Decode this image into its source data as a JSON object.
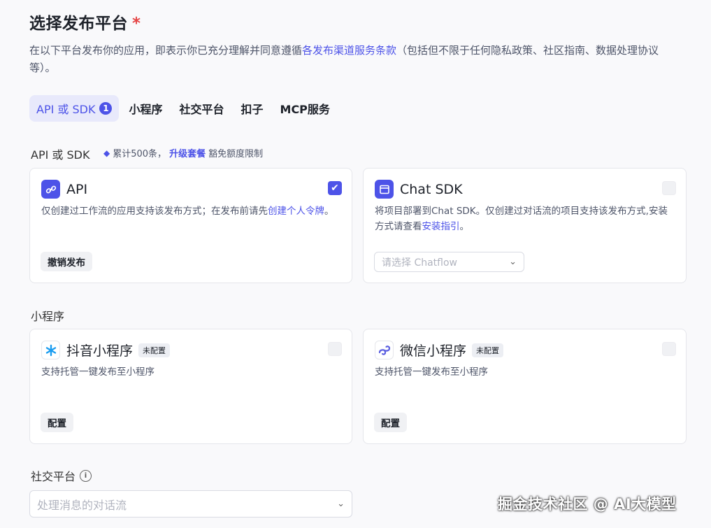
{
  "header": {
    "title": "选择发布平台",
    "required_mark": "*",
    "desc_before": "在以下平台发布你的应用，即表示你已充分理解并同意遵循",
    "desc_link": "各发布渠道服务条款",
    "desc_after": "（包括但不限于任何隐私政策、社区指南、数据处理协议等）。"
  },
  "tabs": [
    {
      "label": "API 或 SDK",
      "badge": "1"
    },
    {
      "label": "小程序"
    },
    {
      "label": "社交平台"
    },
    {
      "label": "扣子"
    },
    {
      "label": "MCP服务"
    }
  ],
  "api_section": {
    "label": "API 或 SDK",
    "quota_text": "累计500条，",
    "upgrade_link": "升级套餐",
    "quota_after": "豁免额度限制"
  },
  "api_card": {
    "title": "API",
    "desc_before": "仅创建过工作流的应用支持该发布方式；在发布前请先",
    "desc_link": "创建个人令牌",
    "desc_after": "。",
    "button": "撤销发布",
    "checked": true
  },
  "chatsdk_card": {
    "title": "Chat SDK",
    "desc_before": "将项目部署到Chat SDK。仅创建过对话流的项目支持该发布方式,安装方式请查看",
    "desc_link": "安装指引",
    "desc_after": "。",
    "select_placeholder": "请选择 Chatflow"
  },
  "mini_section": {
    "label": "小程序"
  },
  "douyin_card": {
    "title": "抖音小程序",
    "status": "未配置",
    "desc": "支持托管一键发布至小程序",
    "button": "配置"
  },
  "wechat_card": {
    "title": "微信小程序",
    "status": "未配置",
    "desc": "支持托管一键发布至小程序",
    "button": "配置"
  },
  "social_section": {
    "label": "社交平台",
    "select_placeholder": "处理消息的对话流"
  },
  "watermark": "掘金技术社区 @ AI大模型",
  "colors": {
    "accent": "#4d53e8",
    "required": "#e54545"
  }
}
